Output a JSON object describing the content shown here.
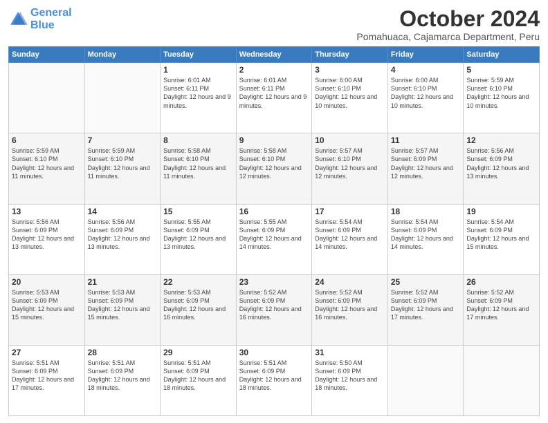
{
  "header": {
    "logo_line1": "General",
    "logo_line2": "Blue",
    "title": "October 2024",
    "subtitle": "Pomahuaca, Cajamarca Department, Peru"
  },
  "days_of_week": [
    "Sunday",
    "Monday",
    "Tuesday",
    "Wednesday",
    "Thursday",
    "Friday",
    "Saturday"
  ],
  "weeks": [
    [
      {
        "day": "",
        "info": ""
      },
      {
        "day": "",
        "info": ""
      },
      {
        "day": "1",
        "info": "Sunrise: 6:01 AM\nSunset: 6:11 PM\nDaylight: 12 hours and 9 minutes."
      },
      {
        "day": "2",
        "info": "Sunrise: 6:01 AM\nSunset: 6:11 PM\nDaylight: 12 hours and 9 minutes."
      },
      {
        "day": "3",
        "info": "Sunrise: 6:00 AM\nSunset: 6:10 PM\nDaylight: 12 hours and 10 minutes."
      },
      {
        "day": "4",
        "info": "Sunrise: 6:00 AM\nSunset: 6:10 PM\nDaylight: 12 hours and 10 minutes."
      },
      {
        "day": "5",
        "info": "Sunrise: 5:59 AM\nSunset: 6:10 PM\nDaylight: 12 hours and 10 minutes."
      }
    ],
    [
      {
        "day": "6",
        "info": "Sunrise: 5:59 AM\nSunset: 6:10 PM\nDaylight: 12 hours and 11 minutes."
      },
      {
        "day": "7",
        "info": "Sunrise: 5:59 AM\nSunset: 6:10 PM\nDaylight: 12 hours and 11 minutes."
      },
      {
        "day": "8",
        "info": "Sunrise: 5:58 AM\nSunset: 6:10 PM\nDaylight: 12 hours and 11 minutes."
      },
      {
        "day": "9",
        "info": "Sunrise: 5:58 AM\nSunset: 6:10 PM\nDaylight: 12 hours and 12 minutes."
      },
      {
        "day": "10",
        "info": "Sunrise: 5:57 AM\nSunset: 6:10 PM\nDaylight: 12 hours and 12 minutes."
      },
      {
        "day": "11",
        "info": "Sunrise: 5:57 AM\nSunset: 6:09 PM\nDaylight: 12 hours and 12 minutes."
      },
      {
        "day": "12",
        "info": "Sunrise: 5:56 AM\nSunset: 6:09 PM\nDaylight: 12 hours and 13 minutes."
      }
    ],
    [
      {
        "day": "13",
        "info": "Sunrise: 5:56 AM\nSunset: 6:09 PM\nDaylight: 12 hours and 13 minutes."
      },
      {
        "day": "14",
        "info": "Sunrise: 5:56 AM\nSunset: 6:09 PM\nDaylight: 12 hours and 13 minutes."
      },
      {
        "day": "15",
        "info": "Sunrise: 5:55 AM\nSunset: 6:09 PM\nDaylight: 12 hours and 13 minutes."
      },
      {
        "day": "16",
        "info": "Sunrise: 5:55 AM\nSunset: 6:09 PM\nDaylight: 12 hours and 14 minutes."
      },
      {
        "day": "17",
        "info": "Sunrise: 5:54 AM\nSunset: 6:09 PM\nDaylight: 12 hours and 14 minutes."
      },
      {
        "day": "18",
        "info": "Sunrise: 5:54 AM\nSunset: 6:09 PM\nDaylight: 12 hours and 14 minutes."
      },
      {
        "day": "19",
        "info": "Sunrise: 5:54 AM\nSunset: 6:09 PM\nDaylight: 12 hours and 15 minutes."
      }
    ],
    [
      {
        "day": "20",
        "info": "Sunrise: 5:53 AM\nSunset: 6:09 PM\nDaylight: 12 hours and 15 minutes."
      },
      {
        "day": "21",
        "info": "Sunrise: 5:53 AM\nSunset: 6:09 PM\nDaylight: 12 hours and 15 minutes."
      },
      {
        "day": "22",
        "info": "Sunrise: 5:53 AM\nSunset: 6:09 PM\nDaylight: 12 hours and 16 minutes."
      },
      {
        "day": "23",
        "info": "Sunrise: 5:52 AM\nSunset: 6:09 PM\nDaylight: 12 hours and 16 minutes."
      },
      {
        "day": "24",
        "info": "Sunrise: 5:52 AM\nSunset: 6:09 PM\nDaylight: 12 hours and 16 minutes."
      },
      {
        "day": "25",
        "info": "Sunrise: 5:52 AM\nSunset: 6:09 PM\nDaylight: 12 hours and 17 minutes."
      },
      {
        "day": "26",
        "info": "Sunrise: 5:52 AM\nSunset: 6:09 PM\nDaylight: 12 hours and 17 minutes."
      }
    ],
    [
      {
        "day": "27",
        "info": "Sunrise: 5:51 AM\nSunset: 6:09 PM\nDaylight: 12 hours and 17 minutes."
      },
      {
        "day": "28",
        "info": "Sunrise: 5:51 AM\nSunset: 6:09 PM\nDaylight: 12 hours and 18 minutes."
      },
      {
        "day": "29",
        "info": "Sunrise: 5:51 AM\nSunset: 6:09 PM\nDaylight: 12 hours and 18 minutes."
      },
      {
        "day": "30",
        "info": "Sunrise: 5:51 AM\nSunset: 6:09 PM\nDaylight: 12 hours and 18 minutes."
      },
      {
        "day": "31",
        "info": "Sunrise: 5:50 AM\nSunset: 6:09 PM\nDaylight: 12 hours and 18 minutes."
      },
      {
        "day": "",
        "info": ""
      },
      {
        "day": "",
        "info": ""
      }
    ]
  ]
}
